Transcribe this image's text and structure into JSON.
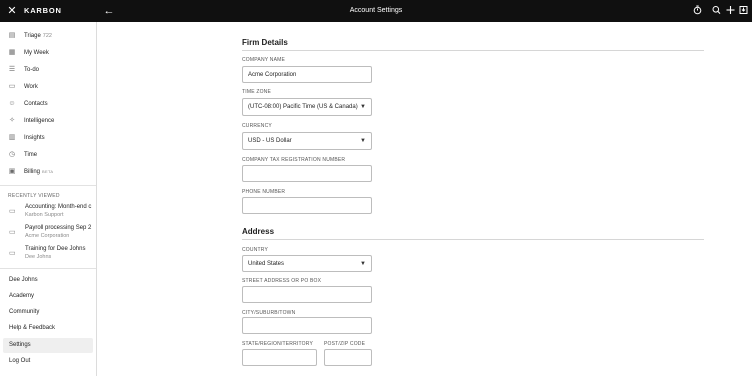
{
  "topbar": {
    "brand": "KARBON",
    "title": "Account Settings",
    "icons": [
      "close-icon",
      "back-arrow-icon",
      "timer-icon",
      "search-icon",
      "plus-icon",
      "inbox-icon"
    ]
  },
  "sidebar": {
    "items": [
      {
        "label": "Triage",
        "count": "722",
        "icon": "triage-icon"
      },
      {
        "label": "My Week",
        "icon": "calendar-icon"
      },
      {
        "label": "To-do",
        "icon": "todo-icon"
      },
      {
        "label": "Work",
        "icon": "briefcase-icon"
      },
      {
        "label": "Contacts",
        "icon": "contacts-icon"
      },
      {
        "label": "Intelligence",
        "icon": "intelligence-icon"
      },
      {
        "label": "Insights",
        "icon": "insights-icon"
      },
      {
        "label": "Time",
        "icon": "clock-icon"
      },
      {
        "label": "Billing",
        "badge": "BETA",
        "icon": "billing-icon"
      }
    ],
    "recently_viewed_heading": "RECENTLY VIEWED",
    "recent": [
      {
        "title": "Accounting: Month-end c",
        "subtitle": "Karbon Support"
      },
      {
        "title": "Payroll processing Sep 2",
        "subtitle": "Acme Corporation"
      },
      {
        "title": "Training for Dee Johns",
        "subtitle": "Dee Johns"
      }
    ],
    "bottom": [
      {
        "label": "Dee Johns"
      },
      {
        "label": "Academy"
      },
      {
        "label": "Community"
      },
      {
        "label": "Help & Feedback"
      },
      {
        "label": "Settings",
        "active": true
      },
      {
        "label": "Log Out"
      }
    ]
  },
  "firm": {
    "title": "Firm Details",
    "company_name_label": "COMPANY NAME",
    "company_name_value": "Acme Corporation",
    "timezone_label": "TIME ZONE",
    "timezone_value": "(UTC-08:00) Pacific Time (US & Canada)",
    "currency_label": "CURRENCY",
    "currency_value": "USD - US Dollar",
    "tax_label": "COMPANY TAX REGISTRATION NUMBER",
    "tax_value": "",
    "phone_label": "PHONE NUMBER",
    "phone_value": ""
  },
  "address": {
    "title": "Address",
    "country_label": "COUNTRY",
    "country_value": "United States",
    "street_label": "STREET ADDRESS OR PO BOX",
    "street_value": "",
    "city_label": "CITY/SUBURB/TOWN",
    "city_value": "",
    "state_label": "STATE/REGION/TERRITORY",
    "state_value": "",
    "zip_label": "POST/ZIP CODE",
    "zip_value": ""
  }
}
